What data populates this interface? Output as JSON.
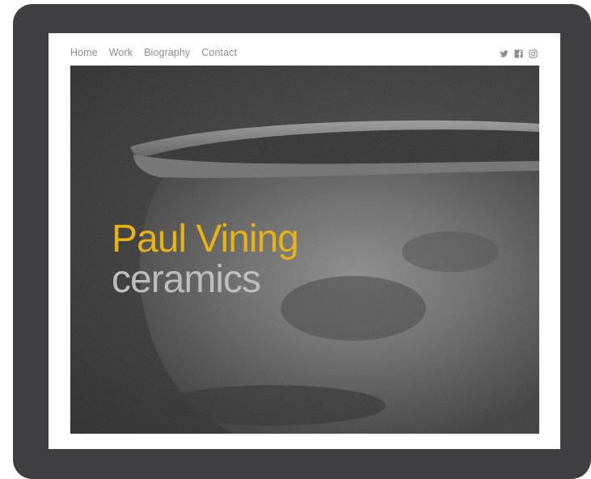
{
  "nav": {
    "items": [
      "Home",
      "Work",
      "Biography",
      "Contact"
    ]
  },
  "social": {
    "icons": [
      "twitter-icon",
      "facebook-icon",
      "instagram-icon"
    ]
  },
  "hero": {
    "title": "Paul Vining",
    "subtitle": "ceramics"
  },
  "colors": {
    "device_frame": "#3f3f41",
    "title": "#e6b214",
    "subtitle": "#bdbdbd",
    "nav_text": "#8c8c8c",
    "icon": "#8c8c8c"
  }
}
